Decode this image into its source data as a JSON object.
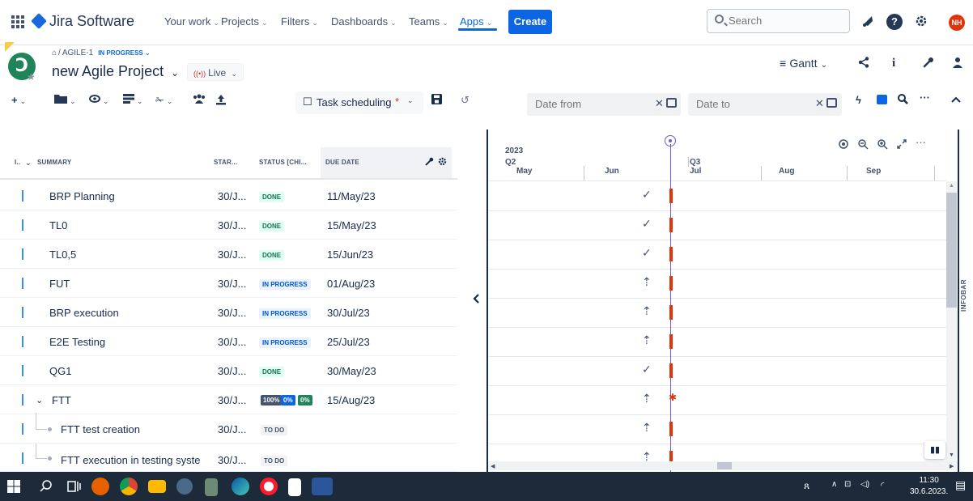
{
  "nav": {
    "brand": "Jira Software",
    "items": [
      {
        "label": "Your work",
        "chevron": "⌄"
      },
      {
        "label": "Projects",
        "chevron": "⌄"
      },
      {
        "label": "Filters",
        "chevron": "⌄"
      },
      {
        "label": "Dashboards",
        "chevron": "⌄"
      },
      {
        "label": "Teams",
        "chevron": "⌄"
      },
      {
        "label": "Apps",
        "chevron": "⌄"
      }
    ],
    "create_label": "Create",
    "search_placeholder": "Search",
    "avatar_initials": "NH",
    "brand_color": "#0c66e4"
  },
  "project": {
    "breadcrumb_sep": "/",
    "issue_key": "AGILE-1",
    "issue_status": "IN PROGRESS",
    "title": "new Agile Project",
    "live_label": "Live",
    "view_label": "Gantt"
  },
  "toolbar": {
    "task_scheduling": "Task scheduling",
    "task_scheduling_mark": "*",
    "date_from_placeholder": "Date from",
    "date_to_placeholder": "Date to",
    "more": "···"
  },
  "table": {
    "headers": {
      "id": "I..",
      "summary": "SUMMARY",
      "start": "STAR...",
      "status": "STATUS [CHI...",
      "due": "DUE DATE"
    },
    "rows": [
      {
        "name": "BRP Planning",
        "start": "30/J...",
        "status": "DONE",
        "due": "11/May/23"
      },
      {
        "name": "TL0",
        "start": "30/J...",
        "status": "DONE",
        "due": "15/May/23"
      },
      {
        "name": "TL0,5",
        "start": "30/J...",
        "status": "DONE",
        "due": "15/Jun/23"
      },
      {
        "name": "FUT",
        "start": "30/J...",
        "status": "IN PROGRESS",
        "due": "01/Aug/23"
      },
      {
        "name": "BRP execution",
        "start": "30/J...",
        "status": "IN PROGRESS",
        "due": "30/Jul/23"
      },
      {
        "name": "E2E Testing",
        "start": "30/J...",
        "status": "IN PROGRESS",
        "due": "25/Jul/23"
      },
      {
        "name": "QG1",
        "start": "30/J...",
        "status": "DONE",
        "due": "30/May/23"
      },
      {
        "name": "FTT",
        "start": "30/J...",
        "status_pcts": [
          "100%",
          "0%",
          "0%"
        ],
        "due": "15/Aug/23"
      },
      {
        "name": "FTT test creation",
        "start": "30/J...",
        "status": "TO DO",
        "due": ""
      },
      {
        "name": "FTT execution in testing syste",
        "start": "30/J...",
        "status": "TO DO",
        "due": ""
      }
    ]
  },
  "gantt": {
    "year": "2023",
    "quarters": [
      "Q2",
      "Q3"
    ],
    "months": [
      "May",
      "Jun",
      "Jul",
      "Aug",
      "Sep"
    ],
    "infobar": "INFOBAR"
  },
  "taskbar": {
    "time": "11:30",
    "date": "30.6.2023."
  }
}
